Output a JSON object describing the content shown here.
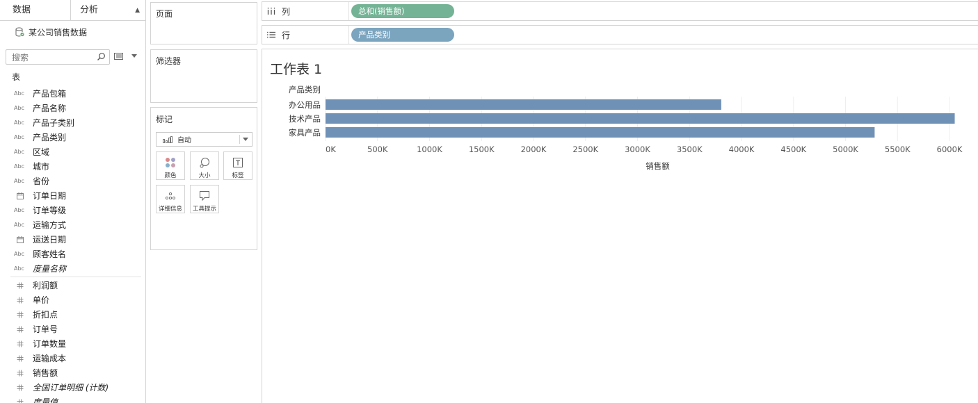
{
  "left_pane": {
    "tabs": {
      "data": "数据",
      "analysis": "分析"
    },
    "datasource": "某公司销售数据",
    "search": {
      "placeholder": "搜索"
    },
    "table_label": "表",
    "dimensions": [
      {
        "type": "Abc",
        "name": "产品包箱"
      },
      {
        "type": "Abc",
        "name": "产品名称"
      },
      {
        "type": "Abc",
        "name": "产品子类别"
      },
      {
        "type": "Abc",
        "name": "产品类别"
      },
      {
        "type": "Abc",
        "name": "区域"
      },
      {
        "type": "Abc",
        "name": "城市"
      },
      {
        "type": "Abc",
        "name": "省份"
      },
      {
        "type": "date",
        "name": "订单日期"
      },
      {
        "type": "Abc",
        "name": "订单等级"
      },
      {
        "type": "Abc",
        "name": "运输方式"
      },
      {
        "type": "date",
        "name": "运送日期"
      },
      {
        "type": "Abc",
        "name": "顾客姓名"
      },
      {
        "type": "Abc",
        "name": "度量名称",
        "italic": true
      }
    ],
    "measures": [
      {
        "type": "#",
        "name": "利润额"
      },
      {
        "type": "#",
        "name": "单价"
      },
      {
        "type": "#",
        "name": "折扣点"
      },
      {
        "type": "#",
        "name": "订单号"
      },
      {
        "type": "#",
        "name": "订单数量"
      },
      {
        "type": "#",
        "name": "运输成本"
      },
      {
        "type": "#",
        "name": "销售额"
      },
      {
        "type": "#",
        "name": "全国订单明细 (计数)",
        "italic": true
      },
      {
        "type": "#",
        "name": "度量值",
        "italic": true
      }
    ]
  },
  "cards": {
    "pages": "页面",
    "filters": "筛选器",
    "marks": {
      "title": "标记",
      "mark_type": "自动",
      "buttons": {
        "color": "颜色",
        "size": "大小",
        "label": "标签",
        "detail": "详细信息",
        "tooltip": "工具提示"
      }
    }
  },
  "shelves": {
    "columns": {
      "label": "列",
      "pill": "总和(销售额)",
      "pill_color": "#74b395"
    },
    "rows": {
      "label": "行",
      "pill": "产品类别",
      "pill_color": "#7ba4bf"
    }
  },
  "sheet": {
    "title": "工作表 1"
  },
  "chart_data": {
    "type": "bar",
    "orientation": "horizontal",
    "row_header": "产品类别",
    "categories": [
      "办公用品",
      "技术产品",
      "家具产品"
    ],
    "values": [
      3805000,
      6050000,
      5280000
    ],
    "xlabel": "销售额",
    "xlim": [
      0,
      6120000
    ],
    "xticks": [
      0,
      500000,
      1000000,
      1500000,
      2000000,
      2500000,
      3000000,
      3500000,
      4000000,
      4500000,
      5000000,
      5500000,
      6000000
    ],
    "xtick_labels": [
      "0K",
      "500K",
      "1000K",
      "1500K",
      "2000K",
      "2500K",
      "3000K",
      "3500K",
      "4000K",
      "4500K",
      "5000K",
      "5500K",
      "6000K"
    ],
    "grid": true,
    "bar_color": "#7091b6"
  }
}
